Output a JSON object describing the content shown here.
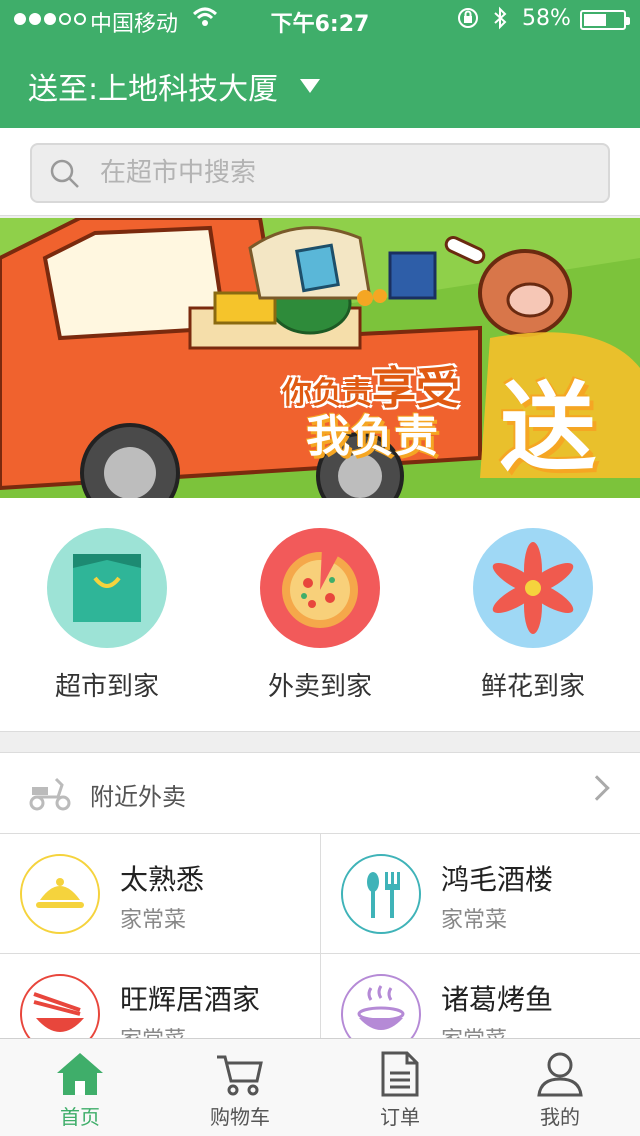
{
  "status_bar": {
    "carrier": "中国移动",
    "time": "下午6:27",
    "battery_percent_text": "58%",
    "battery_level": 0.58
  },
  "header": {
    "delivery_address": "送至:上地科技大厦"
  },
  "search": {
    "placeholder": "在超市中搜索"
  },
  "banner": {
    "slogan_small": "你负责",
    "slogan_big": "享受",
    "slogan_line2": "我负责",
    "slogan_word": "送",
    "slide_count": 5,
    "active_slide": 3
  },
  "categories": [
    {
      "label": "超市到家",
      "icon": "shopping-bag-icon",
      "color": "#9de3d6"
    },
    {
      "label": "外卖到家",
      "icon": "pizza-icon",
      "color": "#f25a5a"
    },
    {
      "label": "鲜花到家",
      "icon": "flower-icon",
      "color": "#9fd8f5"
    }
  ],
  "nearby": {
    "title": "附近外卖"
  },
  "shops": [
    {
      "name": "太熟悉",
      "type": "家常菜",
      "icon": "food-cloche-icon",
      "color": "#f5d33d"
    },
    {
      "name": "鸿毛酒楼",
      "type": "家常菜",
      "icon": "spoon-fork-icon",
      "color": "#3fb3b8"
    },
    {
      "name": "旺辉居酒家",
      "type": "家常菜",
      "icon": "bowl-chopsticks-icon",
      "color": "#e8463c"
    },
    {
      "name": "诸葛烤鱼",
      "type": "家常菜",
      "icon": "noodle-bowl-icon",
      "color": "#b58ad6"
    }
  ],
  "tabs": [
    {
      "label": "首页",
      "icon": "home-icon",
      "active": true
    },
    {
      "label": "购物车",
      "icon": "cart-icon",
      "active": false
    },
    {
      "label": "订单",
      "icon": "order-icon",
      "active": false
    },
    {
      "label": "我的",
      "icon": "user-icon",
      "active": false
    }
  ],
  "colors": {
    "brand_green": "#3fae6a",
    "active_dot": "#e8463c"
  }
}
